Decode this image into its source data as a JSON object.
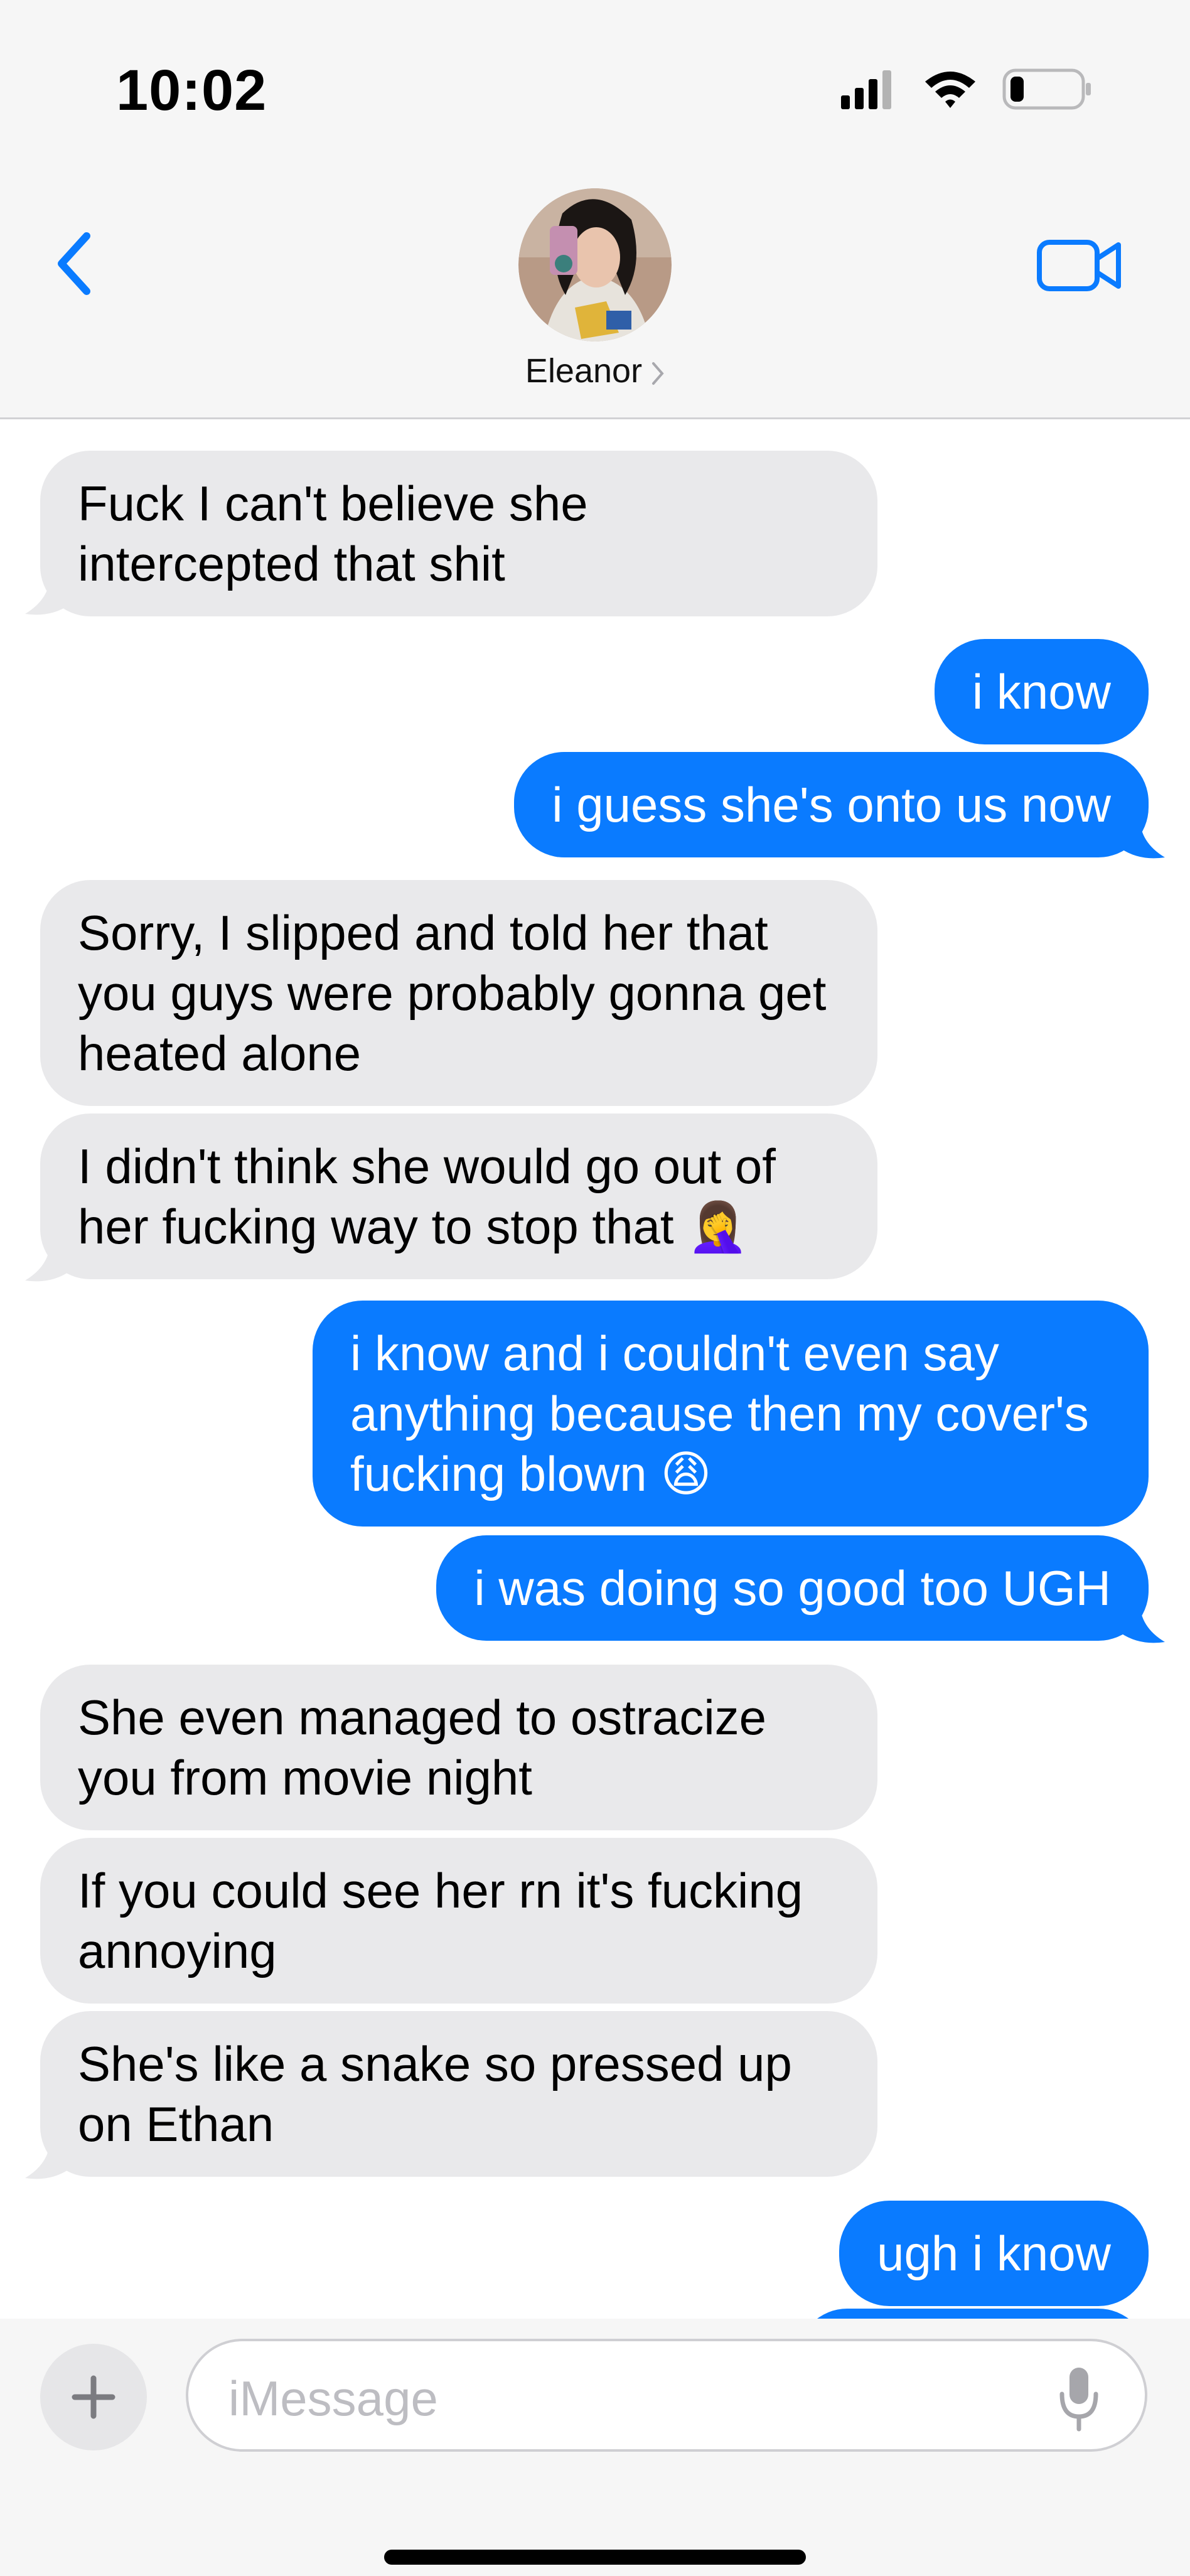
{
  "status_bar": {
    "time": "10:02",
    "battery_level": 0.2
  },
  "header": {
    "contact_name": "Eleanor"
  },
  "colors": {
    "accent": "#0a7bff",
    "incoming_bubble": "#e9e9eb",
    "outgoing_bubble": "#0a7bff"
  },
  "messages": [
    {
      "dir": "in",
      "text": "Fuck I can't believe she intercepted that shit"
    },
    {
      "dir": "out",
      "text": "i know"
    },
    {
      "dir": "out",
      "text": "i guess she's onto us now"
    },
    {
      "dir": "in",
      "text": "Sorry, I slipped and told her that you guys were probably gonna get heated alone"
    },
    {
      "dir": "in",
      "text": "I didn't think she would go out of her fucking way to stop that 🤦‍♀️"
    },
    {
      "dir": "out",
      "text": "i know and i couldn't even say anything because then my cover's fucking blown 😩"
    },
    {
      "dir": "out",
      "text": "i was doing so good too UGH"
    },
    {
      "dir": "in",
      "text": "She even managed to ostracize you from movie night"
    },
    {
      "dir": "in",
      "text": "If you could see her rn it's fucking annoying"
    },
    {
      "dir": "in",
      "text": "She's like a snake so pressed up on Ethan"
    },
    {
      "dir": "out",
      "text": "ugh i know"
    }
  ],
  "composer": {
    "placeholder": "iMessage",
    "plus_icon": "plus-icon",
    "mic_icon": "mic-icon"
  },
  "icons": {
    "back": "chevron-left-icon",
    "video": "video-camera-icon",
    "signal": "cellular-signal-icon",
    "wifi": "wifi-icon",
    "battery": "battery-icon"
  }
}
